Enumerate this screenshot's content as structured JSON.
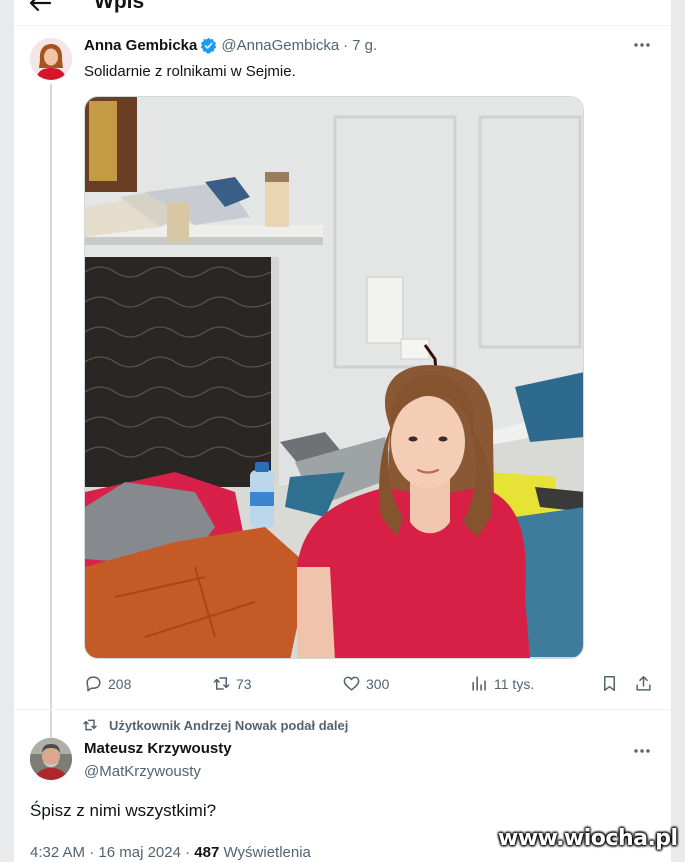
{
  "header": {
    "title": "Wpis",
    "back_icon": "arrow-left-icon"
  },
  "tweet": {
    "author_name": "Anna Gembicka",
    "verified_icon": "verified-badge-icon",
    "handle": "@AnnaGembicka",
    "separator": "·",
    "time_ago": "7 g.",
    "text": "Solidarnie z rolnikami w Sejmie.",
    "more_icon": "more-icon",
    "actions": {
      "replies": "208",
      "reposts": "73",
      "likes": "300",
      "views": "11 tys."
    },
    "colors": {
      "verified": "#1d9bf0",
      "secondary_text": "#536471"
    }
  },
  "repost_notice": {
    "icon": "repost-icon",
    "text": "Użytkownik Andrzej Nowak podał dalej"
  },
  "tweet2": {
    "author_name": "Mateusz Krzywousty",
    "handle": "@MatKrzywousty",
    "more_icon": "more-icon",
    "text": "Śpisz z nimi wszystkimi?",
    "time": "4:32 AM",
    "sep1": "·",
    "date": "16 maj 2024",
    "sep2": "·",
    "views_count": "487",
    "views_label": "Wyświetlenia"
  },
  "watermark": {
    "text": "www.wiocha.pl"
  }
}
